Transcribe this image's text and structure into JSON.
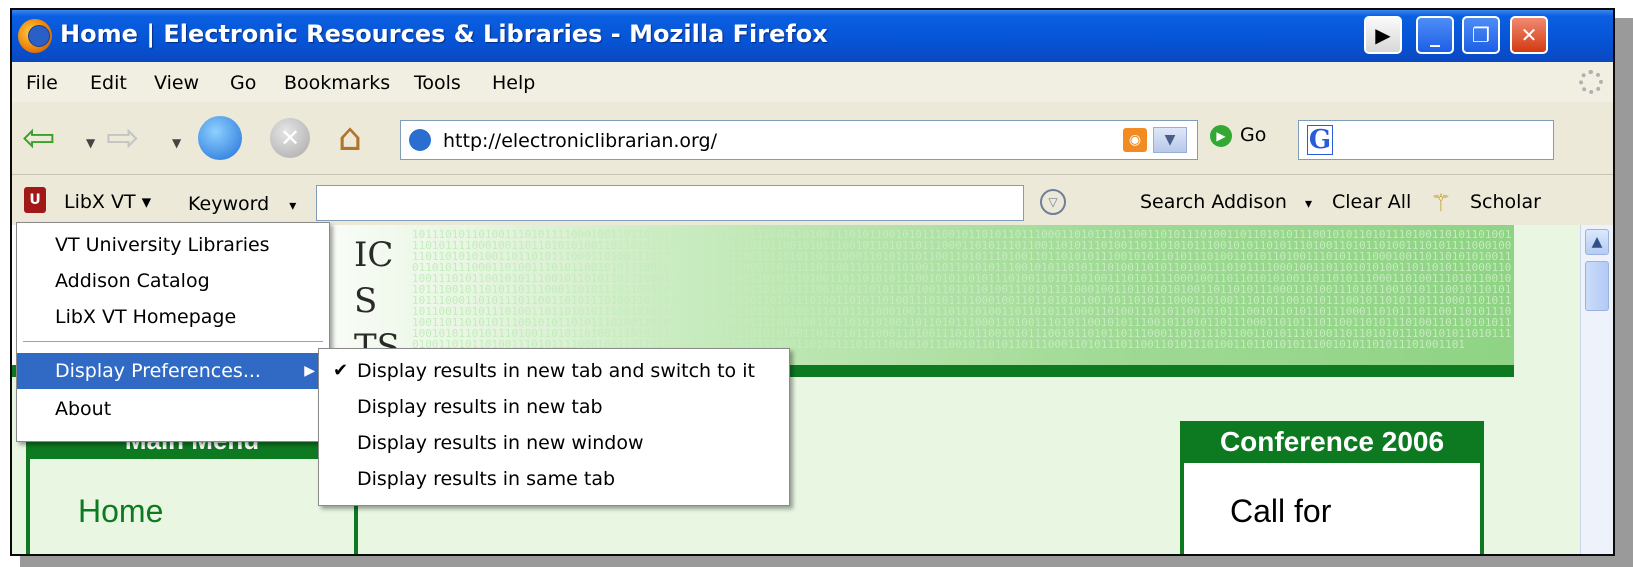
{
  "window": {
    "title": "Home | Electronic Resources & Libraries - Mozilla Firefox"
  },
  "menubar": {
    "items": [
      "File",
      "Edit",
      "View",
      "Go",
      "Bookmarks",
      "Tools",
      "Help"
    ]
  },
  "navbar": {
    "url": "http://electroniclibrarian.org/",
    "go_label": "Go",
    "google_letter": "G"
  },
  "libx": {
    "edition_label": "LibX VT ▾",
    "search_type_label": "Keyword",
    "search_type_arrow": "▾",
    "search_addison_label": "Search Addison",
    "search_addison_arrow": "▾",
    "clear_all_label": "Clear All",
    "scholar_label": "Scholar",
    "menu": {
      "items": [
        "VT University Libraries",
        "Addison Catalog",
        "LibX VT Homepage"
      ],
      "display_preferences": "Display Preferences...",
      "about": "About"
    },
    "submenu": {
      "items": [
        {
          "label": "Display results in new tab and switch to it",
          "checked": true
        },
        {
          "label": "Display results in new tab",
          "checked": false
        },
        {
          "label": "Display results in new window",
          "checked": false
        },
        {
          "label": "Display results in same tab",
          "checked": false
        }
      ]
    }
  },
  "page": {
    "banner_letters": [
      "IC",
      "S",
      "TS"
    ],
    "main_menu_title": "Main Menu",
    "home_link": "Home",
    "conference_title": "Conference 2006",
    "conference_text": "Call for",
    "accent_color": "#0d7a22"
  }
}
